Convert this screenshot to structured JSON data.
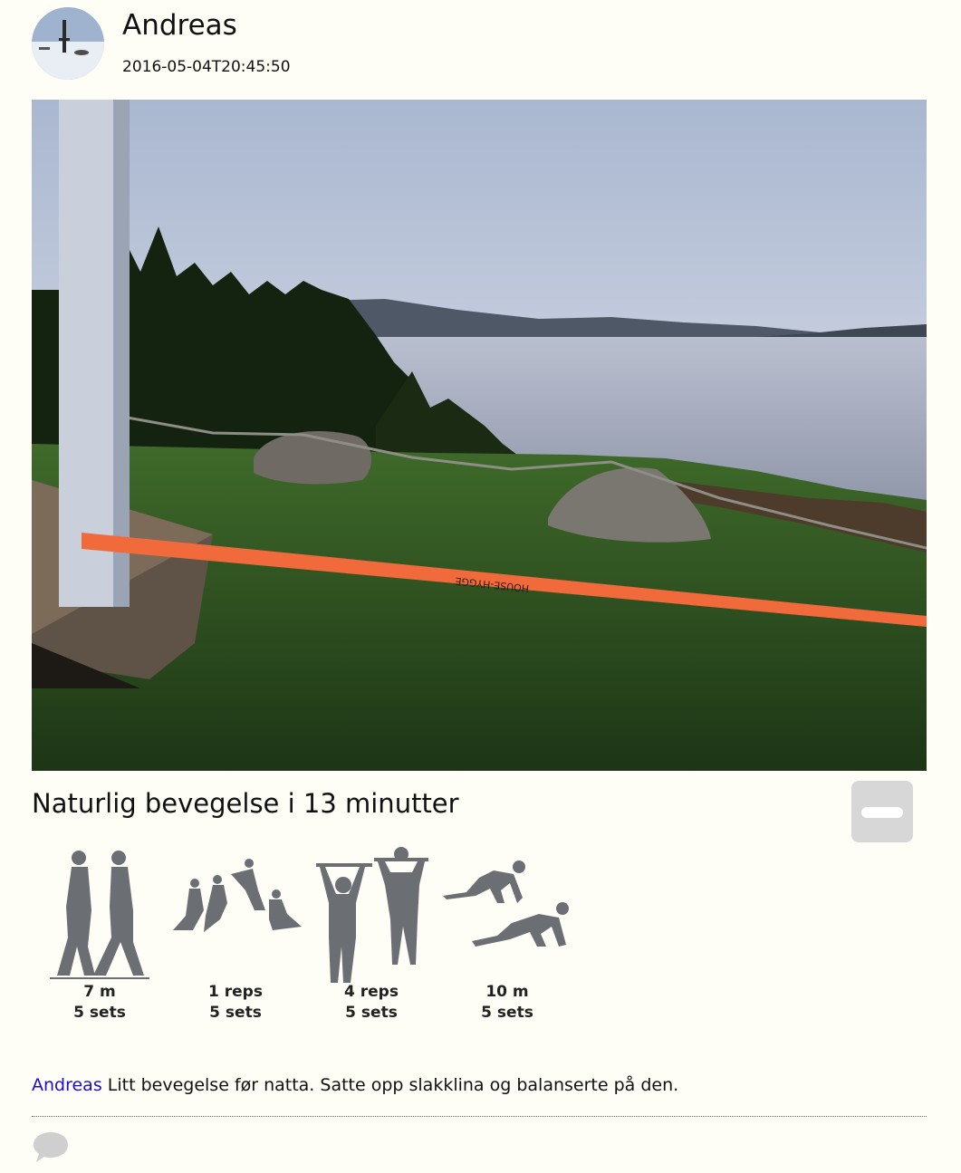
{
  "post": {
    "author": "Andreas",
    "timestamp": "2016-05-04T20:45:50",
    "photo_strap_text": "HOUSE-HYGGE"
  },
  "workout": {
    "title": "Naturlig bevegelse i 13 minutter",
    "exercises": [
      {
        "icon": "walking-figures-icon",
        "amount": "7 m",
        "sets": "5 sets"
      },
      {
        "icon": "jumping-figures-icon",
        "amount": "1 reps",
        "sets": "5 sets"
      },
      {
        "icon": "pull-up-figures-icon",
        "amount": "4 reps",
        "sets": "5 sets"
      },
      {
        "icon": "crawling-figures-icon",
        "amount": "10 m",
        "sets": "5 sets"
      }
    ]
  },
  "comment": {
    "author": "Andreas",
    "text": " Litt bevegelse før natta. Satte opp slakklina og balanserte på den."
  },
  "colors": {
    "background": "#fefef7",
    "link": "#1a0dcc",
    "collapse_button": "#d7d7d7",
    "figure": "#6b6f74",
    "comment_icon": "#cfcfcf"
  }
}
